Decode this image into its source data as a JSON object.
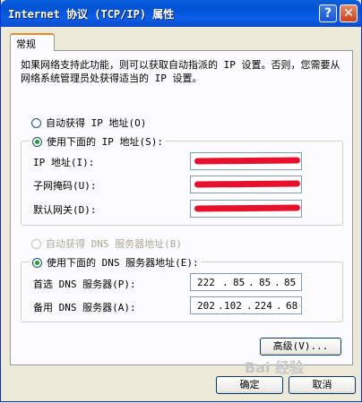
{
  "window": {
    "title": "Internet 协议 (TCP/IP) 属性",
    "help_label": "?",
    "close_label": "✕"
  },
  "tabs": [
    {
      "label": "常规"
    }
  ],
  "description": "如果网络支持此功能，则可以获取自动指派的 IP 设置。否则，您需要从网络系统管理员处获得适当的 IP 设置。",
  "ip": {
    "auto_label": "自动获得 IP 地址(O)",
    "manual_label": "使用下面的 IP 地址(S):",
    "selected": "manual",
    "fields": [
      {
        "label": "IP 地址(I):",
        "redacted": true
      },
      {
        "label": "子网掩码(U):",
        "redacted": true
      },
      {
        "label": "默认网关(D):",
        "redacted": true
      }
    ]
  },
  "dns": {
    "auto_label": "自动获得 DNS 服务器地址(B)",
    "manual_label": "使用下面的 DNS 服务器地址(E):",
    "selected": "manual",
    "preferred": {
      "label": "首选 DNS 服务器(P):",
      "octets": [
        "222",
        "85",
        "85",
        "85"
      ]
    },
    "alternate": {
      "label": "备用 DNS 服务器(A):",
      "octets": [
        "202",
        "102",
        "224",
        "68"
      ]
    }
  },
  "advanced_label": "高级(V)...",
  "ok_label": "确定",
  "cancel_label": "取消",
  "watermark": "Bai 经验",
  "colors": {
    "title_bar": "#0a5fdc",
    "redaction": "#e8102a",
    "radio_dot": "#21a121"
  }
}
